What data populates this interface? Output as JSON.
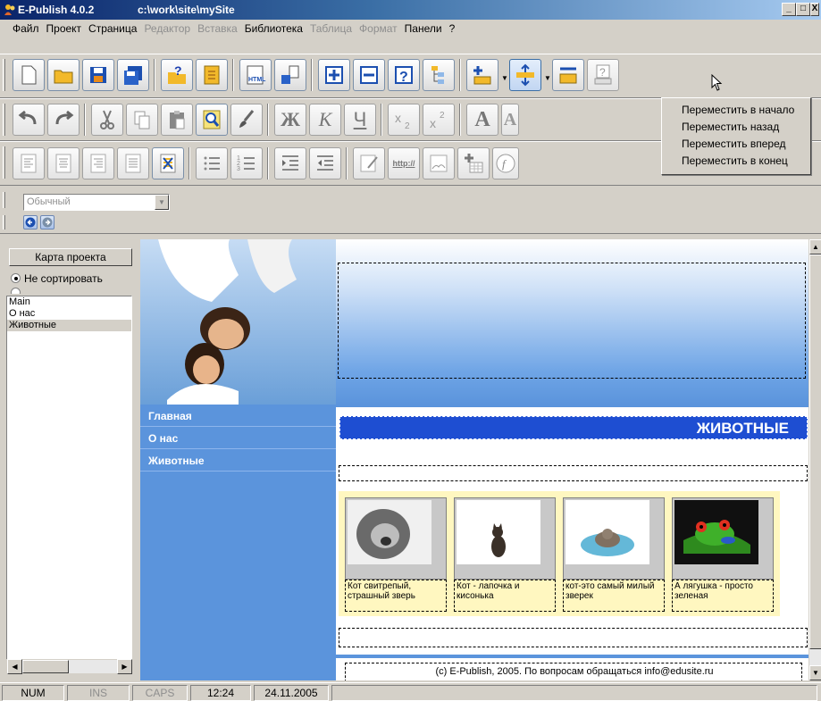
{
  "window": {
    "app_title": "E-Publish 4.0.2",
    "path": "c:\\work\\site\\mySite",
    "controls": [
      "_",
      "□",
      "X"
    ]
  },
  "menubar": {
    "items": [
      {
        "label": "Файл",
        "enabled": true
      },
      {
        "label": "Проект",
        "enabled": true
      },
      {
        "label": "Страница",
        "enabled": true
      },
      {
        "label": "Редактор",
        "enabled": false
      },
      {
        "label": "Вставка",
        "enabled": false
      },
      {
        "label": "Библиотека",
        "enabled": true
      },
      {
        "label": "Таблица",
        "enabled": false
      },
      {
        "label": "Формат",
        "enabled": false
      },
      {
        "label": "Панели",
        "enabled": true
      },
      {
        "label": "?",
        "enabled": true
      }
    ]
  },
  "toolbar": {
    "text_buttons": {
      "bold": "Ж",
      "italic": "К",
      "underline": "Ч",
      "font_big": "A",
      "font_small": "A",
      "link": "http://",
      "html": "HTML"
    },
    "style_combo": {
      "value": "Обычный"
    }
  },
  "dropdown": {
    "items": [
      "Переместить в начало",
      "Переместить назад",
      "Переместить вперед",
      "Переместить в конец"
    ]
  },
  "left_panel": {
    "project_map_button": "Карта проекта",
    "sort_options": [
      {
        "label": "Не сортировать",
        "selected": true
      }
    ],
    "pages": [
      {
        "label": "Main",
        "selected": false
      },
      {
        "label": "О нас",
        "selected": false
      },
      {
        "label": "Животные",
        "selected": true
      }
    ]
  },
  "webpage": {
    "nav": [
      "Главная",
      "О нас",
      "Животные"
    ],
    "page_heading": "ЖИВОТНЫЕ",
    "gallery": [
      {
        "caption": "Кот свитрепый, страшный зверь"
      },
      {
        "caption": "Кот - лапочка и кисонька"
      },
      {
        "caption": "кот-это самый милый зверек"
      },
      {
        "caption": "А лягушка - просто зеленая"
      }
    ],
    "footer_text": "(c) E-Publish, 2005. По вопросам обращаться",
    "footer_email": "info@edusite.ru"
  },
  "statusbar": {
    "num": "NUM",
    "ins": "INS",
    "caps": "CAPS",
    "time": "12:24",
    "date": "24.11.2005"
  },
  "colors": {
    "accent_blue": "#1e4ed2",
    "nav_blue": "#5b94dc",
    "gallery_bg": "#fff7c0"
  }
}
